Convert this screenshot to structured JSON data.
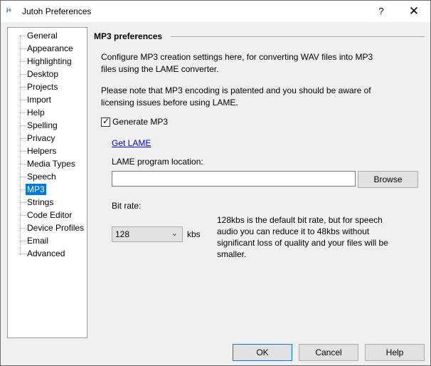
{
  "window": {
    "title": "Jutoh Preferences",
    "help_glyph": "?",
    "close_glyph": "✕",
    "app_icon_glyph": "ʲᶜ"
  },
  "nav": {
    "items": [
      {
        "label": "General"
      },
      {
        "label": "Appearance"
      },
      {
        "label": "Highlighting"
      },
      {
        "label": "Desktop"
      },
      {
        "label": "Projects"
      },
      {
        "label": "Import"
      },
      {
        "label": "Help"
      },
      {
        "label": "Spelling"
      },
      {
        "label": "Privacy"
      },
      {
        "label": "Helpers"
      },
      {
        "label": "Media Types"
      },
      {
        "label": "Speech"
      },
      {
        "label": "MP3"
      },
      {
        "label": "Strings"
      },
      {
        "label": "Code Editor"
      },
      {
        "label": "Device Profiles"
      },
      {
        "label": "Email"
      },
      {
        "label": "Advanced"
      }
    ],
    "selected": "MP3"
  },
  "panel": {
    "title": "MP3 preferences",
    "description1": "Configure MP3 creation settings here, for converting WAV files into MP3 files using the LAME converter.",
    "description2": "Please note that MP3 encoding is patented and you should be aware of licensing issues before using LAME.",
    "generate_mp3": {
      "label": "Generate MP3",
      "checked": true,
      "check_glyph": "✓"
    },
    "get_lame_link": "Get LAME",
    "lame_location": {
      "label": "LAME program location:",
      "value": "",
      "placeholder": ""
    },
    "browse_label": "Browse",
    "bit_rate": {
      "label": "Bit rate:",
      "value": "128",
      "unit": "kbs",
      "chevron_glyph": "⌄"
    },
    "bit_rate_hint": "128kbs is the default bit rate, but for speech audio you can reduce it to 48kbs without significant loss of quality and your files will be smaller."
  },
  "footer": {
    "ok_label": "OK",
    "cancel_label": "Cancel",
    "help_label": "Help"
  },
  "colors": {
    "selection": "#0078d7",
    "link": "#0000ee",
    "dialog_bg": "#f0f0f0"
  }
}
